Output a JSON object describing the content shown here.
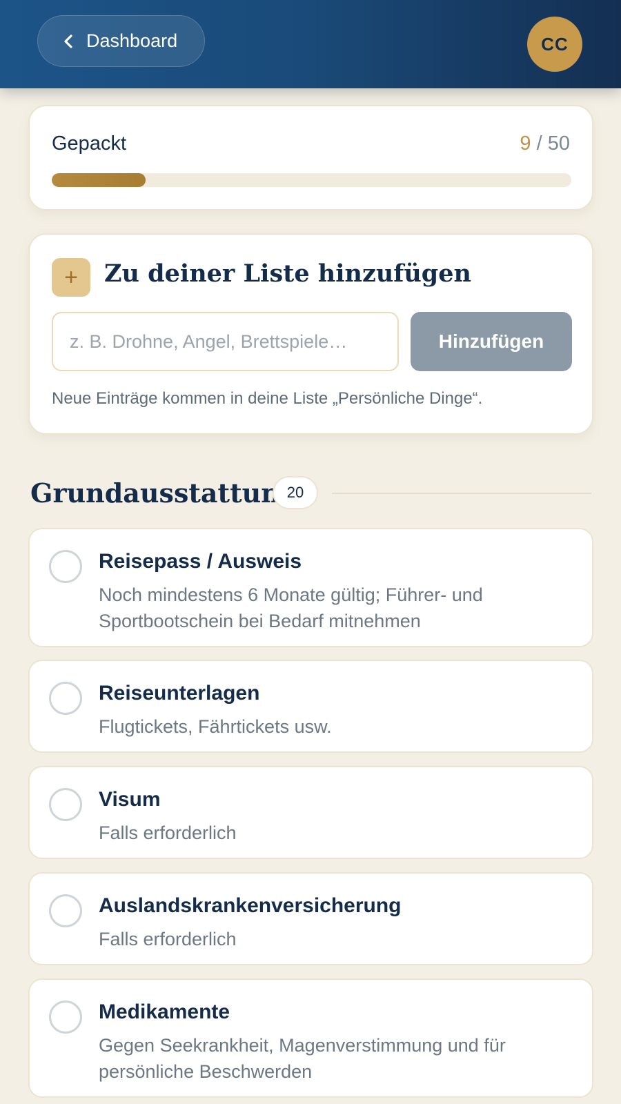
{
  "header": {
    "back_label": "Dashboard",
    "avatar_initials": "CC"
  },
  "progress": {
    "label": "Gepackt",
    "done": "9",
    "separator": " / ",
    "total": "50",
    "fraction": 0.18
  },
  "add_form": {
    "title": "Zu deiner Liste hinzufügen",
    "input_placeholder": "z. B. Drohne, Angel, Brettspiele…",
    "input_value": "",
    "button_label": "Hinzufügen",
    "hint": "Neue Einträge kommen in deine Liste „Persönliche Dinge“."
  },
  "section": {
    "title": "Grundausstattung",
    "count": "20",
    "items": [
      {
        "name": "Reisepass / Ausweis",
        "desc": "Noch mindestens 6 Monate gültig; Führer- und Sportbootschein bei Bedarf mitnehmen",
        "checked": false
      },
      {
        "name": "Reiseunterlagen",
        "desc": "Flugtickets, Fährtickets usw.",
        "checked": false
      },
      {
        "name": "Visum",
        "desc": "Falls erforderlich",
        "checked": false
      },
      {
        "name": "Auslandskrankenversicherung",
        "desc": "Falls erforderlich",
        "checked": false
      },
      {
        "name": "Medikamente",
        "desc": "Gegen Seekrankheit, Magenverstimmung und für persönliche Beschwerden",
        "checked": false
      }
    ]
  },
  "colors": {
    "header": "#1c5488",
    "accent_gold": "#c79a4c",
    "background": "#f4efe4",
    "button_disabled": "#8c99a7"
  },
  "icons": {
    "back": "chevron-left-icon",
    "add": "plus-icon",
    "checkbox": "circle-checkbox-icon"
  }
}
